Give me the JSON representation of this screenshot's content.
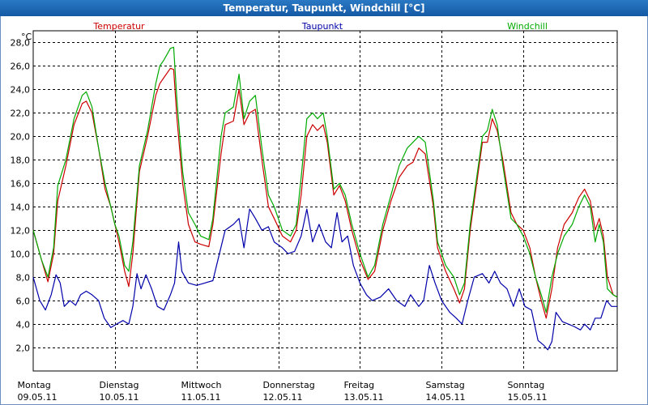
{
  "window": {
    "title": "Temperatur, Taupunkt, Windchill [°C]"
  },
  "colors": {
    "temperature": "#cc0000",
    "dewpoint": "#0000aa",
    "windchill": "#00aa00",
    "grid": "#000000",
    "titlebar": "#1f69b8"
  },
  "chart_data": {
    "type": "line",
    "title": "Temperatur, Taupunkt, Windchill [°C]",
    "ylabel": "°C",
    "ylim": [
      0,
      29
    ],
    "grid": true,
    "legend": "top",
    "y_ticks": [
      "2,0",
      "4,0",
      "6,0",
      "8,0",
      "10,0",
      "12,0",
      "14,0",
      "16,0",
      "18,0",
      "20,0",
      "22,0",
      "24,0",
      "26,0",
      "28,0"
    ],
    "y_tick_values": [
      2,
      4,
      6,
      8,
      10,
      12,
      14,
      16,
      18,
      20,
      22,
      24,
      26,
      28
    ],
    "xlim": [
      0,
      7.15
    ],
    "x_ticks": [
      {
        "day": "Montag",
        "date": "09.05.11",
        "value": 0
      },
      {
        "day": "Dienstag",
        "date": "10.05.11",
        "value": 1
      },
      {
        "day": "Mittwoch",
        "date": "11.05.11",
        "value": 2
      },
      {
        "day": "Donnerstag",
        "date": "12.05.11",
        "value": 3
      },
      {
        "day": "Freitag",
        "date": "13.05.11",
        "value": 4
      },
      {
        "day": "Samstag",
        "date": "14.05.11",
        "value": 5
      },
      {
        "day": "Sonntag",
        "date": "15.05.11",
        "value": 6
      }
    ],
    "series": [
      {
        "name": "Temperatur",
        "color": "#cc0000",
        "points": [
          [
            0.0,
            12.0
          ],
          [
            0.1,
            9.5
          ],
          [
            0.18,
            7.6
          ],
          [
            0.25,
            10.0
          ],
          [
            0.3,
            14.5
          ],
          [
            0.4,
            17.5
          ],
          [
            0.5,
            21.0
          ],
          [
            0.6,
            22.8
          ],
          [
            0.65,
            23.0
          ],
          [
            0.72,
            22.0
          ],
          [
            0.8,
            19.0
          ],
          [
            0.88,
            15.5
          ],
          [
            0.95,
            14.0
          ],
          [
            1.0,
            12.5
          ],
          [
            1.05,
            11.0
          ],
          [
            1.12,
            8.5
          ],
          [
            1.17,
            7.2
          ],
          [
            1.22,
            10.0
          ],
          [
            1.3,
            17.0
          ],
          [
            1.4,
            20.0
          ],
          [
            1.5,
            23.5
          ],
          [
            1.55,
            24.5
          ],
          [
            1.6,
            25.0
          ],
          [
            1.68,
            25.8
          ],
          [
            1.72,
            25.7
          ],
          [
            1.76,
            21.5
          ],
          [
            1.83,
            16.0
          ],
          [
            1.9,
            12.5
          ],
          [
            1.98,
            11.0
          ],
          [
            2.05,
            10.8
          ],
          [
            2.15,
            10.6
          ],
          [
            2.2,
            12.5
          ],
          [
            2.3,
            18.5
          ],
          [
            2.35,
            21.0
          ],
          [
            2.45,
            21.3
          ],
          [
            2.52,
            24.0
          ],
          [
            2.58,
            21.0
          ],
          [
            2.65,
            22.0
          ],
          [
            2.72,
            22.3
          ],
          [
            2.8,
            18.0
          ],
          [
            2.88,
            14.0
          ],
          [
            2.95,
            13.0
          ],
          [
            3.05,
            11.5
          ],
          [
            3.15,
            11.0
          ],
          [
            3.22,
            12.0
          ],
          [
            3.28,
            15.0
          ],
          [
            3.35,
            20.0
          ],
          [
            3.42,
            21.0
          ],
          [
            3.48,
            20.5
          ],
          [
            3.55,
            21.0
          ],
          [
            3.6,
            19.5
          ],
          [
            3.68,
            15.0
          ],
          [
            3.75,
            15.8
          ],
          [
            3.82,
            14.5
          ],
          [
            3.9,
            12.0
          ],
          [
            4.0,
            9.5
          ],
          [
            4.1,
            7.8
          ],
          [
            4.18,
            8.5
          ],
          [
            4.28,
            12.0
          ],
          [
            4.38,
            14.5
          ],
          [
            4.48,
            16.5
          ],
          [
            4.58,
            17.5
          ],
          [
            4.65,
            17.8
          ],
          [
            4.72,
            19.0
          ],
          [
            4.8,
            18.5
          ],
          [
            4.9,
            14.0
          ],
          [
            4.95,
            10.5
          ],
          [
            5.05,
            8.5
          ],
          [
            5.15,
            7.0
          ],
          [
            5.22,
            5.8
          ],
          [
            5.28,
            7.0
          ],
          [
            5.35,
            12.0
          ],
          [
            5.42,
            15.5
          ],
          [
            5.5,
            19.5
          ],
          [
            5.56,
            19.5
          ],
          [
            5.62,
            21.5
          ],
          [
            5.68,
            20.5
          ],
          [
            5.75,
            18.0
          ],
          [
            5.85,
            13.5
          ],
          [
            5.92,
            12.5
          ],
          [
            6.0,
            12.0
          ],
          [
            6.08,
            10.5
          ],
          [
            6.15,
            8.0
          ],
          [
            6.22,
            6.0
          ],
          [
            6.28,
            4.5
          ],
          [
            6.35,
            7.0
          ],
          [
            6.42,
            10.5
          ],
          [
            6.5,
            12.5
          ],
          [
            6.6,
            13.5
          ],
          [
            6.68,
            14.8
          ],
          [
            6.75,
            15.5
          ],
          [
            6.82,
            14.5
          ],
          [
            6.88,
            12.0
          ],
          [
            6.93,
            13.0
          ],
          [
            6.98,
            11.5
          ],
          [
            7.03,
            8.0
          ],
          [
            7.1,
            6.5
          ],
          [
            7.15,
            6.3
          ]
        ]
      },
      {
        "name": "Taupunkt",
        "color": "#0000aa",
        "points": [
          [
            0.0,
            8.0
          ],
          [
            0.08,
            6.0
          ],
          [
            0.15,
            5.2
          ],
          [
            0.22,
            6.5
          ],
          [
            0.28,
            8.2
          ],
          [
            0.33,
            7.5
          ],
          [
            0.38,
            5.5
          ],
          [
            0.45,
            6.0
          ],
          [
            0.52,
            5.6
          ],
          [
            0.58,
            6.5
          ],
          [
            0.65,
            6.8
          ],
          [
            0.72,
            6.5
          ],
          [
            0.8,
            6.0
          ],
          [
            0.87,
            4.5
          ],
          [
            0.95,
            3.7
          ],
          [
            1.02,
            4.0
          ],
          [
            1.1,
            4.3
          ],
          [
            1.17,
            4.0
          ],
          [
            1.22,
            5.5
          ],
          [
            1.27,
            8.3
          ],
          [
            1.32,
            7.0
          ],
          [
            1.38,
            8.2
          ],
          [
            1.45,
            7.0
          ],
          [
            1.52,
            5.5
          ],
          [
            1.6,
            5.2
          ],
          [
            1.68,
            6.5
          ],
          [
            1.73,
            7.5
          ],
          [
            1.78,
            11.0
          ],
          [
            1.82,
            8.5
          ],
          [
            1.9,
            7.5
          ],
          [
            2.0,
            7.3
          ],
          [
            2.1,
            7.5
          ],
          [
            2.2,
            7.7
          ],
          [
            2.28,
            10.0
          ],
          [
            2.35,
            12.0
          ],
          [
            2.45,
            12.5
          ],
          [
            2.52,
            13.0
          ],
          [
            2.58,
            10.5
          ],
          [
            2.65,
            13.8
          ],
          [
            2.72,
            13.0
          ],
          [
            2.8,
            12.0
          ],
          [
            2.88,
            12.3
          ],
          [
            2.95,
            11.0
          ],
          [
            3.05,
            10.5
          ],
          [
            3.12,
            10.0
          ],
          [
            3.2,
            10.2
          ],
          [
            3.28,
            11.5
          ],
          [
            3.35,
            13.8
          ],
          [
            3.42,
            11.0
          ],
          [
            3.5,
            12.5
          ],
          [
            3.58,
            11.0
          ],
          [
            3.65,
            10.5
          ],
          [
            3.72,
            13.5
          ],
          [
            3.78,
            11.0
          ],
          [
            3.85,
            11.5
          ],
          [
            3.92,
            9.0
          ],
          [
            4.0,
            7.5
          ],
          [
            4.08,
            6.5
          ],
          [
            4.15,
            6.0
          ],
          [
            4.25,
            6.3
          ],
          [
            4.35,
            7.0
          ],
          [
            4.45,
            6.0
          ],
          [
            4.55,
            5.5
          ],
          [
            4.62,
            6.5
          ],
          [
            4.72,
            5.5
          ],
          [
            4.78,
            6.0
          ],
          [
            4.85,
            9.0
          ],
          [
            4.92,
            7.5
          ],
          [
            5.0,
            6.0
          ],
          [
            5.1,
            5.0
          ],
          [
            5.18,
            4.5
          ],
          [
            5.25,
            4.0
          ],
          [
            5.32,
            6.0
          ],
          [
            5.4,
            8.0
          ],
          [
            5.5,
            8.3
          ],
          [
            5.58,
            7.5
          ],
          [
            5.65,
            8.5
          ],
          [
            5.72,
            7.5
          ],
          [
            5.8,
            7.0
          ],
          [
            5.88,
            5.5
          ],
          [
            5.95,
            7.0
          ],
          [
            6.02,
            5.5
          ],
          [
            6.1,
            5.2
          ],
          [
            6.18,
            2.6
          ],
          [
            6.25,
            2.2
          ],
          [
            6.3,
            1.8
          ],
          [
            6.35,
            2.5
          ],
          [
            6.4,
            5.0
          ],
          [
            6.48,
            4.2
          ],
          [
            6.55,
            4.0
          ],
          [
            6.62,
            3.8
          ],
          [
            6.7,
            3.5
          ],
          [
            6.75,
            4.0
          ],
          [
            6.82,
            3.5
          ],
          [
            6.88,
            4.5
          ],
          [
            6.95,
            4.5
          ],
          [
            7.02,
            6.0
          ],
          [
            7.08,
            5.5
          ],
          [
            7.15,
            5.5
          ]
        ]
      },
      {
        "name": "Windchill",
        "color": "#00aa00",
        "points": [
          [
            0.0,
            12.0
          ],
          [
            0.1,
            9.5
          ],
          [
            0.18,
            8.0
          ],
          [
            0.25,
            10.5
          ],
          [
            0.3,
            15.8
          ],
          [
            0.4,
            18.0
          ],
          [
            0.5,
            21.5
          ],
          [
            0.6,
            23.5
          ],
          [
            0.65,
            23.8
          ],
          [
            0.72,
            22.5
          ],
          [
            0.8,
            19.0
          ],
          [
            0.88,
            16.0
          ],
          [
            0.95,
            14.0
          ],
          [
            1.0,
            12.5
          ],
          [
            1.05,
            11.5
          ],
          [
            1.12,
            9.0
          ],
          [
            1.17,
            8.5
          ],
          [
            1.22,
            11.0
          ],
          [
            1.3,
            17.5
          ],
          [
            1.4,
            20.5
          ],
          [
            1.5,
            24.5
          ],
          [
            1.55,
            26.0
          ],
          [
            1.6,
            26.5
          ],
          [
            1.68,
            27.5
          ],
          [
            1.72,
            27.6
          ],
          [
            1.76,
            23.0
          ],
          [
            1.83,
            17.0
          ],
          [
            1.9,
            13.5
          ],
          [
            1.98,
            12.5
          ],
          [
            2.05,
            11.5
          ],
          [
            2.15,
            11.2
          ],
          [
            2.2,
            13.0
          ],
          [
            2.3,
            20.0
          ],
          [
            2.35,
            22.0
          ],
          [
            2.45,
            22.5
          ],
          [
            2.52,
            25.3
          ],
          [
            2.58,
            21.5
          ],
          [
            2.65,
            23.0
          ],
          [
            2.72,
            23.5
          ],
          [
            2.8,
            19.0
          ],
          [
            2.88,
            15.0
          ],
          [
            2.95,
            14.0
          ],
          [
            3.05,
            12.0
          ],
          [
            3.15,
            11.5
          ],
          [
            3.22,
            12.5
          ],
          [
            3.28,
            16.5
          ],
          [
            3.35,
            21.5
          ],
          [
            3.42,
            22.0
          ],
          [
            3.48,
            21.5
          ],
          [
            3.55,
            22.0
          ],
          [
            3.6,
            20.0
          ],
          [
            3.68,
            15.5
          ],
          [
            3.75,
            16.0
          ],
          [
            3.82,
            15.0
          ],
          [
            3.9,
            12.5
          ],
          [
            4.0,
            10.0
          ],
          [
            4.1,
            8.0
          ],
          [
            4.18,
            9.0
          ],
          [
            4.28,
            12.5
          ],
          [
            4.38,
            15.0
          ],
          [
            4.48,
            17.5
          ],
          [
            4.58,
            19.0
          ],
          [
            4.65,
            19.5
          ],
          [
            4.72,
            20.0
          ],
          [
            4.8,
            19.5
          ],
          [
            4.9,
            14.5
          ],
          [
            4.95,
            11.0
          ],
          [
            5.05,
            9.0
          ],
          [
            5.15,
            8.0
          ],
          [
            5.22,
            6.5
          ],
          [
            5.28,
            7.5
          ],
          [
            5.35,
            12.5
          ],
          [
            5.42,
            16.0
          ],
          [
            5.5,
            20.0
          ],
          [
            5.56,
            20.5
          ],
          [
            5.62,
            22.3
          ],
          [
            5.68,
            21.0
          ],
          [
            5.75,
            17.5
          ],
          [
            5.85,
            13.0
          ],
          [
            5.92,
            12.5
          ],
          [
            6.0,
            11.5
          ],
          [
            6.08,
            10.0
          ],
          [
            6.15,
            8.0
          ],
          [
            6.22,
            6.5
          ],
          [
            6.28,
            5.0
          ],
          [
            6.35,
            8.0
          ],
          [
            6.42,
            10.0
          ],
          [
            6.5,
            11.5
          ],
          [
            6.6,
            12.5
          ],
          [
            6.68,
            14.0
          ],
          [
            6.75,
            15.0
          ],
          [
            6.82,
            14.0
          ],
          [
            6.88,
            11.0
          ],
          [
            6.93,
            12.5
          ],
          [
            6.98,
            11.0
          ],
          [
            7.03,
            7.0
          ],
          [
            7.1,
            6.5
          ],
          [
            7.15,
            6.3
          ]
        ]
      }
    ]
  }
}
